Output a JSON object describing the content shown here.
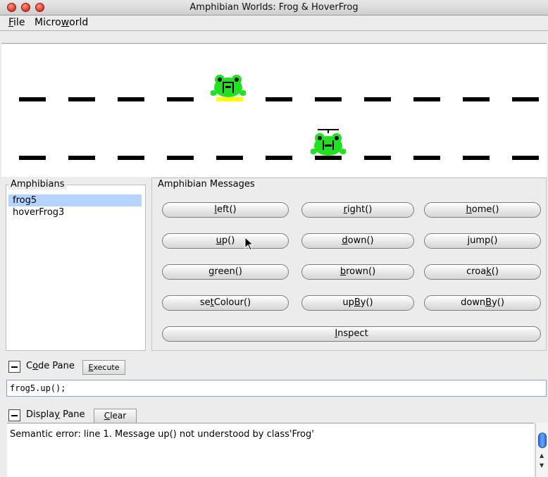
{
  "window": {
    "title": "Amphibian Worlds: Frog & HoverFrog"
  },
  "menu": {
    "file": {
      "pre": "",
      "mn": "F",
      "post": "ile"
    },
    "microworld": {
      "pre": "Micro",
      "mn": "w",
      "post": "orld"
    }
  },
  "amphibians": {
    "title": "Amphibians",
    "items": [
      {
        "label": "frog5",
        "selected": true
      },
      {
        "label": "hoverFrog3",
        "selected": false
      }
    ]
  },
  "messages": {
    "title": "Amphibian Messages",
    "buttons": [
      {
        "pre": "",
        "mn": "l",
        "post": "eft()"
      },
      {
        "pre": "",
        "mn": "r",
        "post": "ight()"
      },
      {
        "pre": "",
        "mn": "h",
        "post": "ome()"
      },
      {
        "pre": "",
        "mn": "u",
        "post": "p()"
      },
      {
        "pre": "",
        "mn": "d",
        "post": "own()"
      },
      {
        "pre": "",
        "mn": "j",
        "post": "ump()"
      },
      {
        "pre": "",
        "mn": "g",
        "post": "reen()"
      },
      {
        "pre": "",
        "mn": "b",
        "post": "rown()"
      },
      {
        "pre": "croa",
        "mn": "k",
        "post": "()"
      },
      {
        "pre": "se",
        "mn": "t",
        "post": "Colour()"
      },
      {
        "pre": "up",
        "mn": "B",
        "post": "y()"
      },
      {
        "pre": "down",
        "mn": "B",
        "post": "y()"
      }
    ],
    "inspect": {
      "pre": "",
      "mn": "I",
      "post": "nspect"
    }
  },
  "code_pane": {
    "label": {
      "pre": "C",
      "mn": "o",
      "post": "de Pane"
    },
    "execute": {
      "pre": "",
      "mn": "E",
      "post": "xecute"
    },
    "code": "frog5.up();"
  },
  "display_pane": {
    "label": {
      "pre": "Displa",
      "mn": "y",
      "post": " Pane"
    },
    "clear": {
      "pre": "",
      "mn": "C",
      "post": "lear"
    },
    "text": "Semantic error: line 1. Message up() not understood by class'Frog'"
  },
  "colors": {
    "frog_green": "#22e022",
    "pad_yellow": "#ffff00",
    "selection": "#b5d3ff"
  }
}
